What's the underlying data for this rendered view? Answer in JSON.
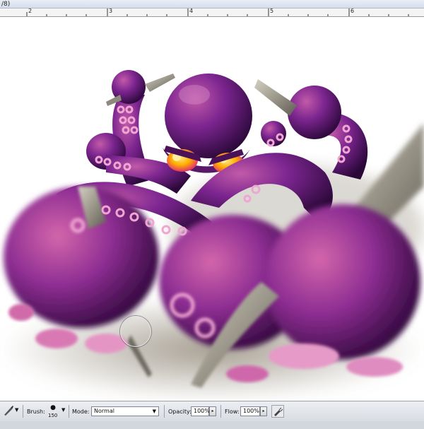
{
  "window": {
    "title_fragment": "/8)"
  },
  "ruler": {
    "labels": [
      "2",
      "3",
      "4",
      "5",
      "6"
    ]
  },
  "options_bar": {
    "brush_label": "Brush:",
    "brush_size": "150",
    "mode_label": "Mode:",
    "mode_value": "Normal",
    "opacity_label": "Opacity:",
    "opacity_value": "100%",
    "flow_label": "Flow:",
    "flow_value": "100%"
  },
  "icons": {
    "brush_tool": "paintbrush-icon",
    "airbrush": "airbrush-icon",
    "dropdown": "chevron-down-icon",
    "slider": "arrow-right-icon"
  },
  "colors": {
    "octopus_dark": "#3b0c4a",
    "octopus_mid": "#7c2590",
    "octopus_light": "#d062a8",
    "sucker_pink": "#f0a6d2",
    "eye_yellow": "#ffc400",
    "pen_gray": "#a9a594",
    "shadow": "#8e8574"
  }
}
